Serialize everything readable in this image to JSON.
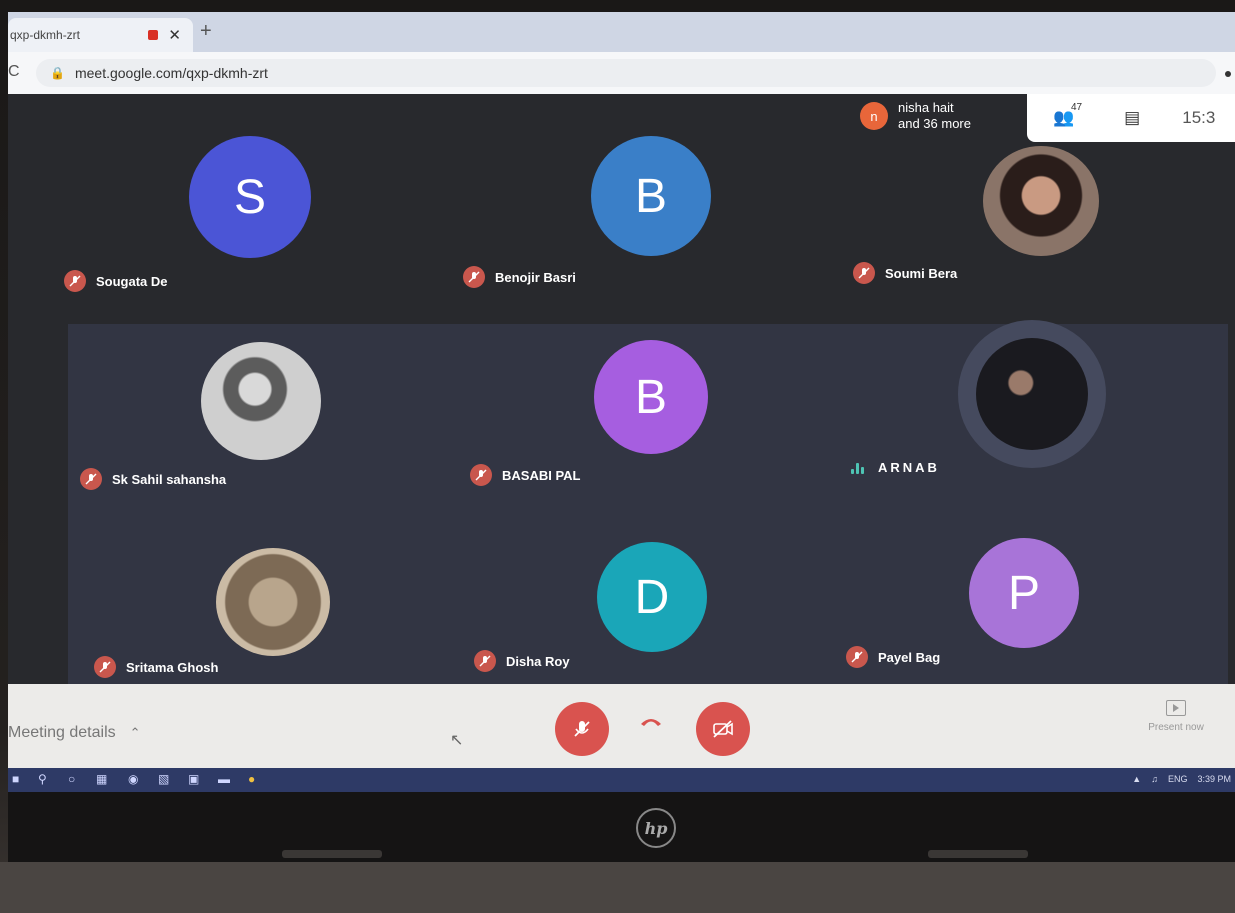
{
  "browser": {
    "tab_title": "qxp-dkmh-zrt",
    "tab_close": "✕",
    "new_tab": "+",
    "url": "meet.google.com/qxp-dkmh-zrt"
  },
  "meet": {
    "presence": {
      "initial": "n",
      "line1": "nisha hait",
      "line2": "and 36 more"
    },
    "participant_count": "47",
    "clock": "15:3",
    "participants": [
      {
        "name": "Sougata De",
        "initial": "S",
        "color": "#4b55d6",
        "muted": true
      },
      {
        "name": "Benojir Basri",
        "initial": "B",
        "color": "#3a7fc8",
        "muted": true
      },
      {
        "name": "Soumi Bera",
        "photo": true,
        "muted": true
      },
      {
        "name": "Sk Sahil sahansha",
        "photo": true,
        "muted": true
      },
      {
        "name": "BASABI PAL",
        "initial": "B",
        "color": "#a65ee0",
        "muted": true
      },
      {
        "name": "ARNAB",
        "photo": true,
        "muted": false,
        "speaking": true
      },
      {
        "name": "Sritama Ghosh",
        "photo": true,
        "muted": true
      },
      {
        "name": "Disha Roy",
        "initial": "D",
        "color": "#1aa6b8",
        "muted": true
      },
      {
        "name": "Payel Bag",
        "initial": "P",
        "color": "#a874d8",
        "muted": true
      }
    ]
  },
  "bottombar": {
    "meeting_details": "Meeting details",
    "present_now": "Present now"
  },
  "taskbar": {
    "tray_lang": "ENG",
    "tray_time": "3:39 PM"
  },
  "laptop": {
    "brand": "hp"
  },
  "colors": {
    "mic_off": "#c9574d",
    "control_red": "#d9534f",
    "speaking": "#4ec4b4"
  }
}
